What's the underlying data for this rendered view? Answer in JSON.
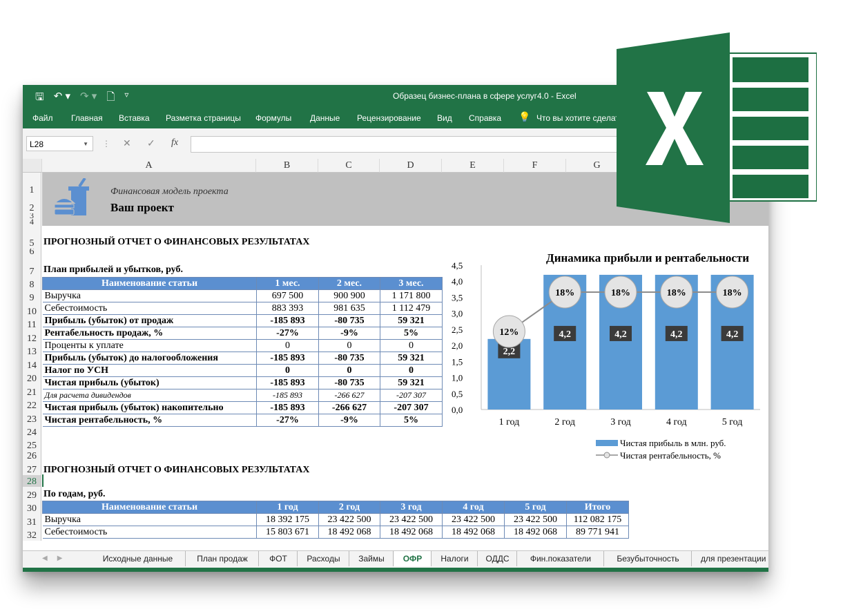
{
  "window": {
    "title": "Образец бизнес-плана в сфере услуг4.0  -  Excel",
    "qat": {
      "save": "🖫",
      "undo": "↶ ▾",
      "redo": "↷ ▾",
      "new": "🗋",
      "customize": "▿"
    }
  },
  "ribbon": {
    "tabs": [
      "Файл",
      "Главная",
      "Вставка",
      "Разметка страницы",
      "Формулы",
      "Данные",
      "Рецензирование",
      "Вид",
      "Справка"
    ],
    "tell_me": "Что вы хотите сделать?"
  },
  "formula_bar": {
    "name_box": "L28",
    "fx": "fx",
    "formula": ""
  },
  "columns": [
    "A",
    "B",
    "C",
    "D",
    "E",
    "F",
    "G"
  ],
  "rows": [
    "1",
    "2",
    "3",
    "4",
    "5",
    "6",
    "7",
    "8",
    "9",
    "10",
    "11",
    "12",
    "13",
    "14",
    "20",
    "21",
    "22",
    "23",
    "24",
    "25",
    "26",
    "27",
    "28",
    "29",
    "30",
    "31",
    "32"
  ],
  "header": {
    "subtitle": "Финансовая модель проекта",
    "project": "Ваш проект"
  },
  "report1": {
    "title": "ПРОГНОЗНЫЙ ОТЧЕТ О ФИНАНСОВЫХ РЕЗУЛЬТАТАХ",
    "subtitle": "План прибылей и убытков,  руб.",
    "head": [
      "Наименование статьи",
      "1 мес.",
      "2 мес.",
      "3 мес."
    ],
    "rows": [
      {
        "name": "Выручка",
        "v": [
          "697 500",
          "900 900",
          "1 171 800"
        ],
        "style": ""
      },
      {
        "name": "Себестоимость",
        "v": [
          "883 393",
          "981 635",
          "1 112 479"
        ],
        "style": ""
      },
      {
        "name": "Прибыль (убыток) от продаж",
        "v": [
          "-185 893",
          "-80 735",
          "59 321"
        ],
        "style": "b"
      },
      {
        "name": "Рентабельность продаж, %",
        "v": [
          "-27%",
          "-9%",
          "5%"
        ],
        "style": "b"
      },
      {
        "name": "Проценты к уплате",
        "v": [
          "0",
          "0",
          "0"
        ],
        "style": ""
      },
      {
        "name": "Прибыль (убыток) до налогообложения",
        "v": [
          "-185 893",
          "-80 735",
          "59 321"
        ],
        "style": "b"
      },
      {
        "name": "Налог по УСН",
        "v": [
          "0",
          "0",
          "0"
        ],
        "style": "b"
      },
      {
        "name": "Чистая прибыль (убыток)",
        "v": [
          "-185 893",
          "-80 735",
          "59 321"
        ],
        "style": "b"
      },
      {
        "name": "Для расчета дивидендов",
        "v": [
          "-185 893",
          "-266 627",
          "-207 307"
        ],
        "style": "i"
      },
      {
        "name": "Чистая прибыль (убыток) накопительно",
        "v": [
          "-185 893",
          "-266 627",
          "-207 307"
        ],
        "style": "b"
      },
      {
        "name": "Чистая рентабельность, %",
        "v": [
          "-27%",
          "-9%",
          "5%"
        ],
        "style": "b"
      }
    ]
  },
  "report2": {
    "title": "ПРОГНОЗНЫЙ ОТЧЕТ О ФИНАНСОВЫХ РЕЗУЛЬТАТАХ",
    "subtitle": "По годам, руб.",
    "head": [
      "Наименование статьи",
      "1 год",
      "2 год",
      "3 год",
      "4 год",
      "5 год",
      "Итого"
    ],
    "rows": [
      {
        "name": "Выручка",
        "v": [
          "18 392 175",
          "23 422 500",
          "23 422 500",
          "23 422 500",
          "23 422 500",
          "112 082 175"
        ]
      },
      {
        "name": "Себестоимость",
        "v": [
          "15 803 671",
          "18 492 068",
          "18 492 068",
          "18 492 068",
          "18 492 068",
          "89 771 941"
        ]
      }
    ]
  },
  "chart_data": {
    "type": "bar",
    "title": "Динамика прибыли и рентабельности",
    "categories": [
      "1 год",
      "2 год",
      "3 год",
      "4 год",
      "5 год"
    ],
    "series": [
      {
        "name": "Чистая прибыль в млн. руб.",
        "values": [
          2.2,
          4.2,
          4.2,
          4.2,
          4.2
        ],
        "labels": [
          "2,2",
          "4,2",
          "4,2",
          "4,2",
          "4,2"
        ],
        "color": "#5b9bd5"
      },
      {
        "name": "Чистая рентабельность, %",
        "values": [
          12,
          18,
          18,
          18,
          18
        ],
        "labels": [
          "12%",
          "18%",
          "18%",
          "18%",
          "18%"
        ],
        "color": "#7f7f7f"
      }
    ],
    "yticks": [
      "0,0",
      "0,5",
      "1,0",
      "1,5",
      "2,0",
      "2,5",
      "3,0",
      "3,5",
      "4,0",
      "4,5"
    ],
    "ylim": [
      0,
      4.5
    ],
    "legend": "bottom"
  },
  "sheet_tabs": [
    {
      "label": "Исходные данные",
      "color": "#5b9bd5",
      "active": false
    },
    {
      "label": "План продаж",
      "color": "#a5a5a5",
      "active": false
    },
    {
      "label": "ФОТ",
      "color": "#5b9bd5",
      "active": false
    },
    {
      "label": "Расходы",
      "color": "#a5a5a5",
      "active": false
    },
    {
      "label": "Займы",
      "color": "#a5a5a5",
      "active": false
    },
    {
      "label": "ОФР",
      "color": "#70ad47",
      "active": true
    },
    {
      "label": "Налоги",
      "color": "#5b9bd5",
      "active": false
    },
    {
      "label": "ОДДС",
      "color": "#a5a5a5",
      "active": false
    },
    {
      "label": "Фин.показатели",
      "color": "#5b9bd5",
      "active": false
    },
    {
      "label": "Безубыточность",
      "color": "#a5a5a5",
      "active": false
    },
    {
      "label": "для презентации",
      "color": "#5b9bd5",
      "active": false
    }
  ],
  "colors": {
    "excel_green": "#217346",
    "header_blue": "#5b8fd0",
    "bar_blue": "#5b9bd5"
  }
}
